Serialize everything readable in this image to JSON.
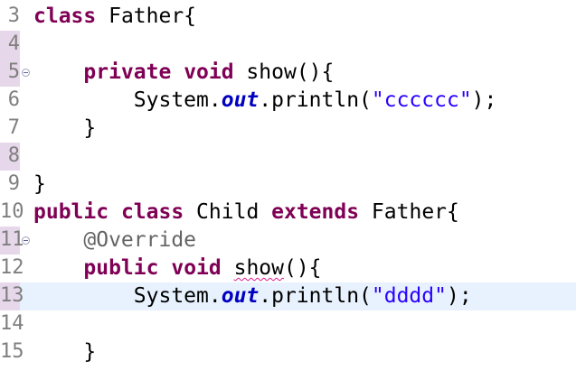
{
  "editor": {
    "lines": [
      {
        "num": "3",
        "tokens": [
          {
            "text": "class",
            "kind": "keyword"
          },
          {
            "text": " Father{",
            "kind": "plain"
          }
        ]
      },
      {
        "num": "4",
        "tokens": []
      },
      {
        "num": "5",
        "tokens": [
          {
            "text": "    ",
            "kind": "plain"
          },
          {
            "text": "private",
            "kind": "keyword"
          },
          {
            "text": " ",
            "kind": "plain"
          },
          {
            "text": "void",
            "kind": "keyword"
          },
          {
            "text": " show(){",
            "kind": "plain"
          }
        ]
      },
      {
        "num": "6",
        "tokens": [
          {
            "text": "        System.",
            "kind": "plain"
          },
          {
            "text": "out",
            "kind": "field"
          },
          {
            "text": ".println(",
            "kind": "plain"
          },
          {
            "text": "\"cccccc\"",
            "kind": "string"
          },
          {
            "text": ");",
            "kind": "plain"
          }
        ]
      },
      {
        "num": "7",
        "tokens": [
          {
            "text": "    }",
            "kind": "plain"
          }
        ]
      },
      {
        "num": "8",
        "tokens": []
      },
      {
        "num": "9",
        "tokens": [
          {
            "text": "}",
            "kind": "plain"
          }
        ]
      },
      {
        "num": "10",
        "tokens": [
          {
            "text": "public",
            "kind": "keyword"
          },
          {
            "text": " ",
            "kind": "plain"
          },
          {
            "text": "class",
            "kind": "keyword"
          },
          {
            "text": " Child ",
            "kind": "plain"
          },
          {
            "text": "extends",
            "kind": "keyword"
          },
          {
            "text": " Father{",
            "kind": "plain"
          }
        ]
      },
      {
        "num": "11",
        "tokens": [
          {
            "text": "    ",
            "kind": "plain"
          },
          {
            "text": "@Override",
            "kind": "annotation"
          }
        ]
      },
      {
        "num": "12",
        "tokens": [
          {
            "text": "    ",
            "kind": "plain"
          },
          {
            "text": "public",
            "kind": "keyword"
          },
          {
            "text": " ",
            "kind": "plain"
          },
          {
            "text": "void",
            "kind": "keyword"
          },
          {
            "text": " ",
            "kind": "plain"
          },
          {
            "text": "show",
            "kind": "error"
          },
          {
            "text": "(){",
            "kind": "plain"
          }
        ]
      },
      {
        "num": "13",
        "tokens": [
          {
            "text": "        System.",
            "kind": "plain"
          },
          {
            "text": "out",
            "kind": "field"
          },
          {
            "text": ".println(",
            "kind": "plain"
          },
          {
            "text": "\"dddd\"",
            "kind": "string"
          },
          {
            "text": ");",
            "kind": "plain"
          }
        ]
      },
      {
        "num": "14",
        "tokens": []
      },
      {
        "num": "15",
        "tokens": [
          {
            "text": "    }",
            "kind": "plain"
          }
        ]
      }
    ],
    "current_line": "13",
    "marked_lines": [
      "4",
      "5",
      "8",
      "11",
      "13"
    ],
    "fold_lines": [
      "5",
      "11"
    ],
    "colors": {
      "keyword": "#7f0055",
      "string": "#2a00ff",
      "field": "#0000c0",
      "annotation": "#646464",
      "current_line_bg": "#e8f2fe",
      "gutter_marker": "#e6d8ea",
      "error_underline": "#e0188c"
    }
  }
}
